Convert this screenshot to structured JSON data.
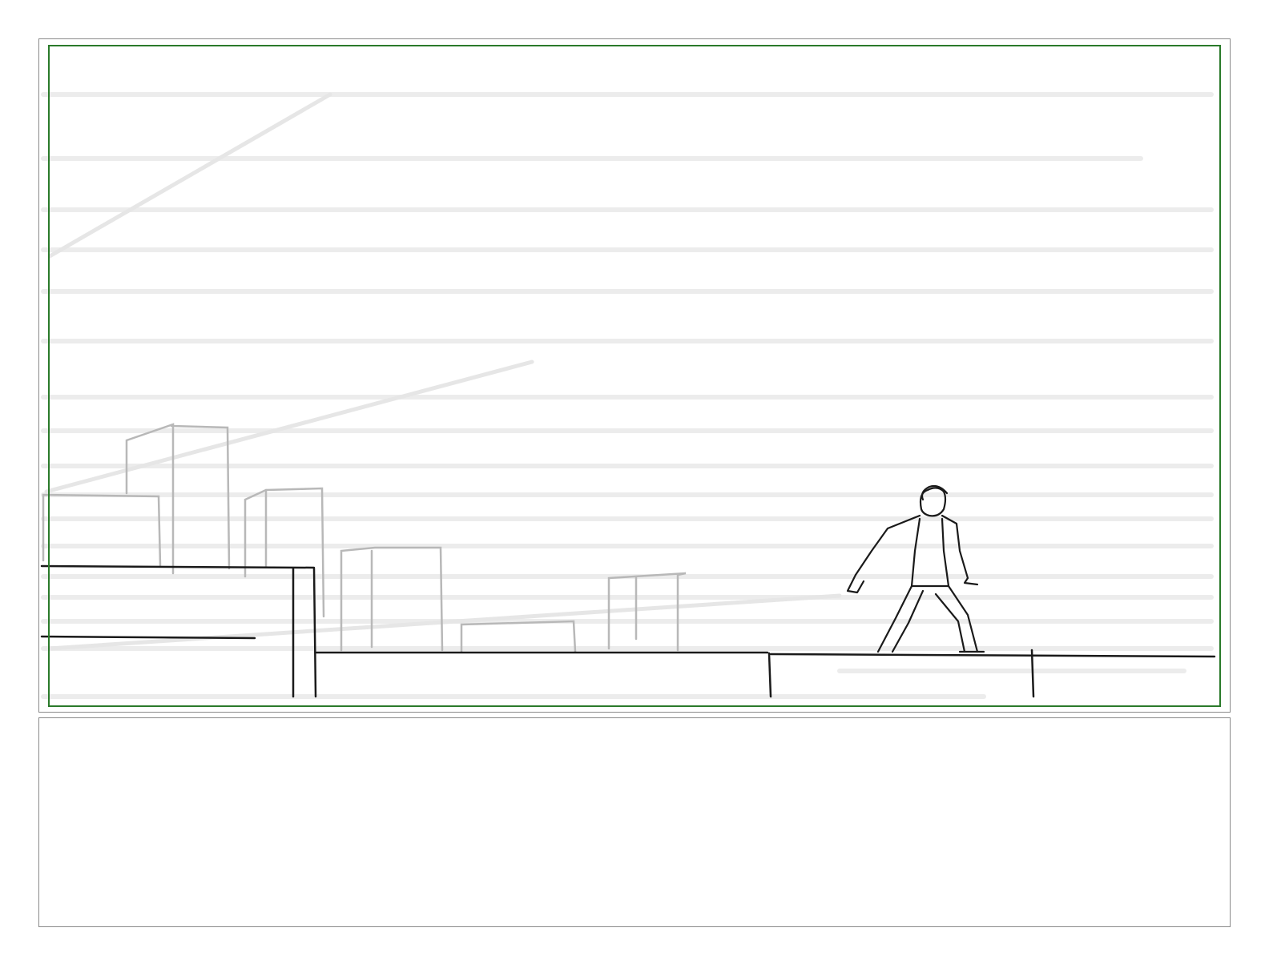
{
  "storyboard": {
    "panel": {
      "frame_color": "#8a8a8a",
      "safe_area_color": "#2a7a2a",
      "scene": "rooftop-sketch-figure-running"
    },
    "notes": {
      "text": ""
    }
  }
}
